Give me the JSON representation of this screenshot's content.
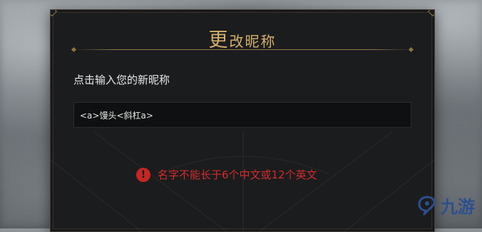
{
  "dialog": {
    "title_first": "更",
    "title_rest": "改昵称",
    "prompt": "点击输入您的新昵称",
    "nickname_value": "<a>馒头<斜杠a>",
    "error_message": "名字不能长于6个中文或12个英文",
    "error_icon_glyph": "!"
  },
  "watermark": {
    "text": "九游"
  },
  "colors": {
    "title_gold": "#d5b06a",
    "error_red": "#d42b2b",
    "panel_bg": "#1b1c1e"
  }
}
